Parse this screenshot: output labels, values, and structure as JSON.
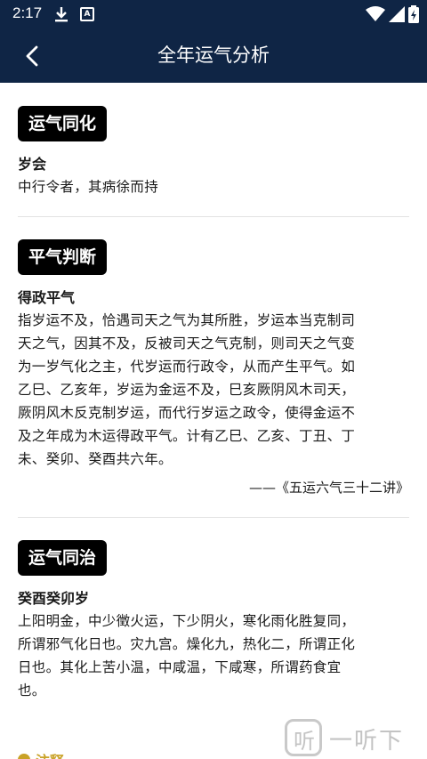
{
  "status": {
    "time": "2:17",
    "app_icon_letter": "A",
    "icons": [
      "download-icon",
      "app-notification-icon",
      "wifi-icon",
      "signal-icon",
      "battery-icon"
    ]
  },
  "appbar": {
    "title": "全年运气分析",
    "back_icon": "chevron-left-icon"
  },
  "sections": [
    {
      "tag": "运气同化",
      "subhead": "岁会",
      "lines": [
        "中行令者，其病徐而持"
      ]
    },
    {
      "tag": "平气判断",
      "subhead": "得政平气",
      "lines": [
        "指岁运不及，恰遇司天之气为其所胜，岁运本当克制司",
        "天之气，因其不及，反被司天之气克制，则司天之气变",
        "为一岁气化之主，代岁运而行政令，从而产生平气。如",
        "乙巳、乙亥年，岁运为金运不及，巳亥厥阴风木司天，",
        "厥阴风木反克制岁运，而代行岁运之政令，使得金运不",
        "及之年成为木运得政平气。计有乙巳、乙亥、丁丑、丁",
        "未、癸卯、癸酉共六年。"
      ],
      "cite": "——《五运六气三十二讲》"
    },
    {
      "tag": "运气同治",
      "subhead": "癸酉癸卯岁",
      "lines": [
        "上阳明金，中少徵火运，下少阴火，寒化雨化胜复同，",
        "所谓邪气化日也。灾九宫。燥化九，热化二，所谓正化",
        "日也。其化上苦小温，中咸温，下咸寒，所谓药食宜",
        "也。"
      ]
    }
  ],
  "note": {
    "label": "注释",
    "color": "#c9a227"
  },
  "watermark": {
    "icon_glyph": "听",
    "text": "一听下载"
  },
  "colors": {
    "header_bg": "#0f2545",
    "tag_bg": "#000000",
    "note_accent": "#c9a227"
  }
}
